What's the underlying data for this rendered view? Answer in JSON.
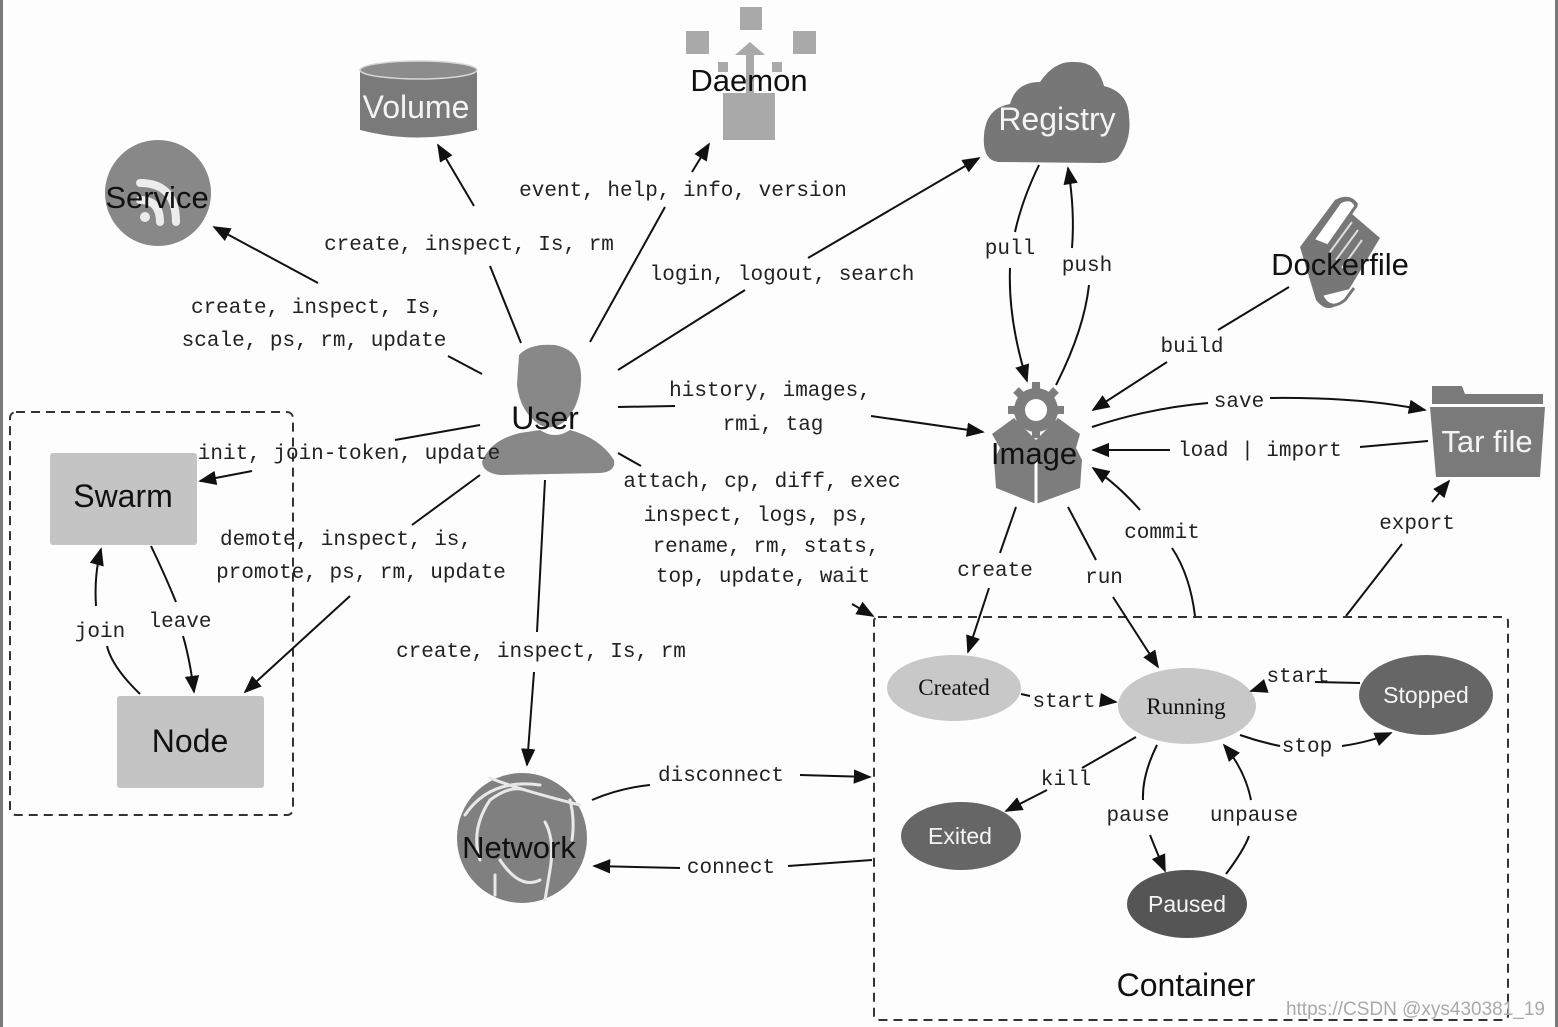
{
  "nodes": {
    "user": "User",
    "volume": "Volume",
    "daemon": "Daemon",
    "registry": "Registry",
    "service": "Service",
    "dockerfile": "Dockerfile",
    "image": "Image",
    "tar_file": "Tar file",
    "swarm": "Swarm",
    "node": "Node",
    "network": "Network",
    "container_group": "Container"
  },
  "container_states": {
    "created": "Created",
    "running": "Running",
    "stopped": "Stopped",
    "exited": "Exited",
    "paused": "Paused"
  },
  "edge_labels": {
    "volume_cmds": "create, inspect, Is, rm",
    "daemon_cmds": "event, help, info, version",
    "registry_cmds": "login, logout, search",
    "service_cmds_1": "create, inspect, Is,",
    "service_cmds_2": "scale, ps, rm, update",
    "image_cmds_1": "history, images,",
    "image_cmds_2": "rmi, tag",
    "container_cmds_1": "attach, cp, diff, exec",
    "container_cmds_2": "inspect, logs, ps,",
    "container_cmds_3": "rename, rm, stats,",
    "container_cmds_4": "top, update, wait",
    "swarm_cmds": "init, join-token, update",
    "node_cmds_1": "demote, inspect, is,",
    "node_cmds_2": "promote, ps, rm, update",
    "network_cmds": "create, inspect, Is, rm",
    "pull": "pull",
    "push": "push",
    "build": "build",
    "save": "save",
    "load_import": "load | import",
    "export": "export",
    "commit": "commit",
    "create": "create",
    "run": "run",
    "join": "join",
    "leave": "leave",
    "disconnect": "disconnect",
    "connect": "connect",
    "start_created": "start",
    "start_stopped": "start",
    "stop": "stop",
    "kill": "kill",
    "pause": "pause",
    "unpause": "unpause"
  },
  "watermark": "https://CSDN @xys430381_19",
  "colors": {
    "dark_node": "#6b6b6b",
    "mid_node": "#8a8a8a",
    "light_node": "#c4c4c4",
    "line": "#111111"
  }
}
